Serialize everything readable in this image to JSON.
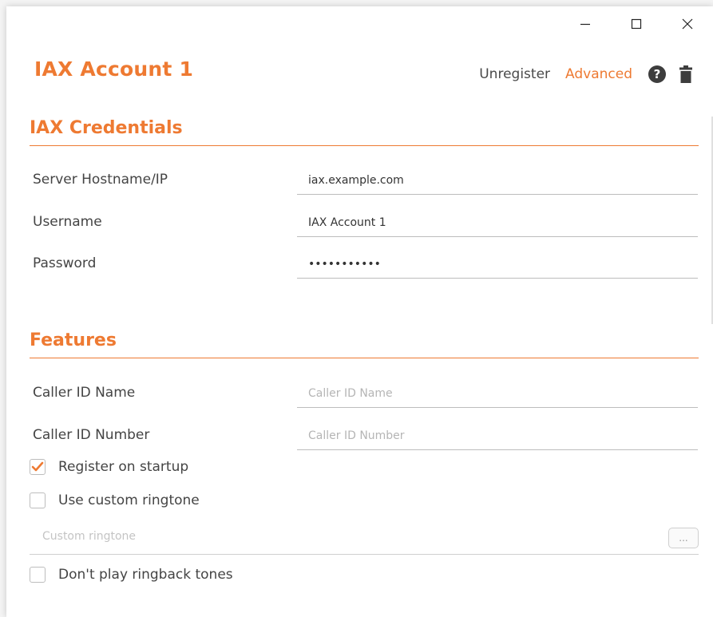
{
  "window": {
    "controls": [
      "minimize",
      "maximize",
      "close"
    ]
  },
  "header": {
    "title": "IAX Account 1",
    "unregister_label": "Unregister",
    "advanced_label": "Advanced",
    "help_glyph": "?"
  },
  "credentials": {
    "section_title": "IAX Credentials",
    "server_label": "Server Hostname/IP",
    "server_value": "iax.example.com",
    "username_label": "Username",
    "username_value": "IAX Account 1",
    "password_label": "Password",
    "password_value": "password123"
  },
  "features": {
    "section_title": "Features",
    "caller_id_name_label": "Caller ID Name",
    "caller_id_name_placeholder": "Caller ID Name",
    "caller_id_number_label": "Caller ID Number",
    "caller_id_number_placeholder": "Caller ID Number",
    "register_on_startup_label": "Register on startup",
    "register_on_startup_checked": true,
    "use_custom_ringtone_label": "Use custom ringtone",
    "use_custom_ringtone_checked": false,
    "custom_ringtone_placeholder": "Custom ringtone",
    "browse_label": "...",
    "dont_play_ringback_label": "Don't play ringback tones",
    "dont_play_ringback_checked": false
  },
  "colors": {
    "accent": "#ee7a32",
    "text": "#444444",
    "icon_dark": "#3d3d3d"
  }
}
